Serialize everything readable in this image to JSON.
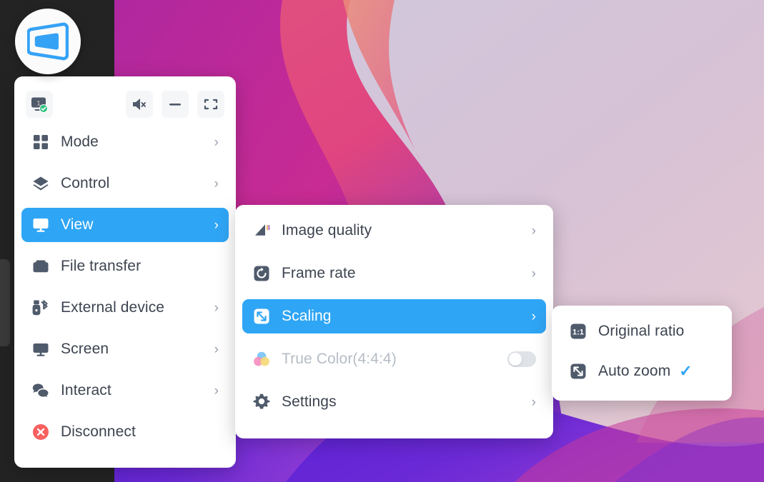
{
  "app": {
    "logo_icon": "remote-desktop-logo-icon",
    "accent_color": "#2fa5f5",
    "panel_bg": "#ffffff",
    "text_color": "#3d4450",
    "disabled_text_color": "#b6bcc6",
    "danger_color": "#f9605f",
    "desktop_dark": "#232323"
  },
  "toolbar": {
    "items": [
      {
        "id": "monitor-1",
        "icon": "monitor-screen-1-connected-icon",
        "label": "1",
        "badge": "check"
      },
      {
        "id": "mute",
        "icon": "speaker-mute-icon",
        "label": ""
      },
      {
        "id": "minimize",
        "icon": "minimize-icon",
        "label": ""
      },
      {
        "id": "fullscreen",
        "icon": "fullscreen-icon",
        "label": ""
      }
    ]
  },
  "main_menu": {
    "items": [
      {
        "label": "Mode",
        "icon": "grid-squares-icon",
        "arrow": "›",
        "selected": false,
        "disabled": false
      },
      {
        "label": "Control",
        "icon": "layers-icon",
        "arrow": "›",
        "selected": false,
        "disabled": false
      },
      {
        "label": "View",
        "icon": "monitor-icon",
        "arrow": "›",
        "selected": true,
        "disabled": false
      },
      {
        "label": "File transfer",
        "icon": "folder-icon",
        "arrow": "",
        "selected": false,
        "disabled": false
      },
      {
        "label": "External device",
        "icon": "usb-bluetooth-icon",
        "arrow": "›",
        "selected": false,
        "disabled": false
      },
      {
        "label": "Screen",
        "icon": "display-icon",
        "arrow": "›",
        "selected": false,
        "disabled": false
      },
      {
        "label": "Interact",
        "icon": "chat-bubbles-icon",
        "arrow": "›",
        "selected": false,
        "disabled": false
      },
      {
        "label": "Disconnect",
        "icon": "disconnect-close-icon",
        "arrow": "",
        "selected": false,
        "disabled": false
      }
    ]
  },
  "view_menu": {
    "items": [
      {
        "label": "Image quality",
        "icon": "signal-quality-icon",
        "arrow": "›",
        "selected": false,
        "disabled": false,
        "toggle": null
      },
      {
        "label": "Frame rate",
        "icon": "refresh-rate-icon",
        "arrow": "›",
        "selected": false,
        "disabled": false,
        "toggle": null
      },
      {
        "label": "Scaling",
        "icon": "scaling-arrows-icon",
        "arrow": "›",
        "selected": true,
        "disabled": false,
        "toggle": null
      },
      {
        "label": "True Color(4:4:4)",
        "icon": "color-circles-icon",
        "arrow": "",
        "selected": false,
        "disabled": true,
        "toggle": "off"
      },
      {
        "label": "Settings",
        "icon": "gear-icon",
        "arrow": "›",
        "selected": false,
        "disabled": false,
        "toggle": null
      }
    ]
  },
  "scaling_menu": {
    "items": [
      {
        "label": "Original ratio",
        "icon": "one-to-one-ratio-icon",
        "checked": false,
        "check_mark": ""
      },
      {
        "label": "Auto zoom",
        "icon": "scaling-arrows-icon",
        "checked": true,
        "check_mark": "✓"
      }
    ]
  }
}
